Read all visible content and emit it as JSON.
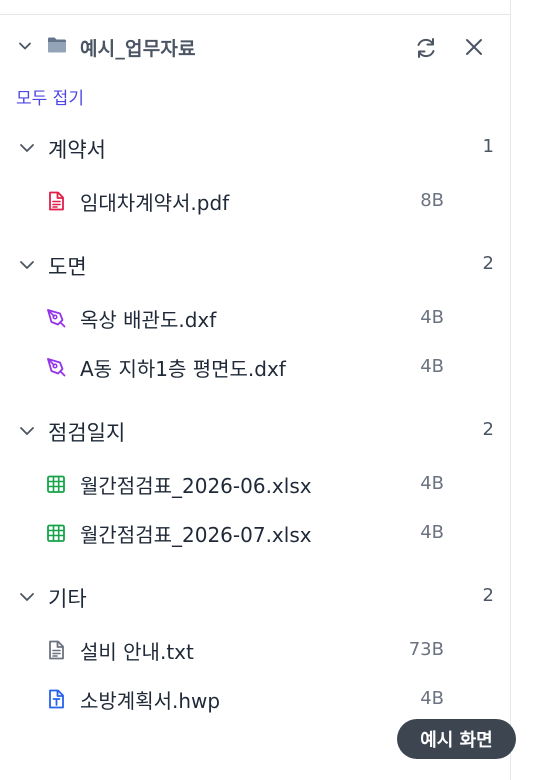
{
  "header": {
    "title": "예시_업무자료",
    "folder_icon": "folder-icon",
    "refresh_icon": "refresh-icon",
    "close_icon": "close-icon"
  },
  "toolbar": {
    "collapse_all_label": "모두 접기"
  },
  "colors": {
    "accent": "#4f46e5",
    "pdf": "#e11d48",
    "dxf": "#9333ea",
    "xlsx": "#16a34a",
    "txt": "#6b7280",
    "hwp": "#2563eb",
    "badge_bg": "#3d4550"
  },
  "groups": [
    {
      "name": "계약서",
      "count": "1",
      "files": [
        {
          "name": "임대차계약서.pdf",
          "size": "8B",
          "icon": "pdf-file-icon"
        }
      ]
    },
    {
      "name": "도면",
      "count": "2",
      "files": [
        {
          "name": "옥상 배관도.dxf",
          "size": "4B",
          "icon": "pen-tool-icon"
        },
        {
          "name": "A동 지하1층 평면도.dxf",
          "size": "4B",
          "icon": "pen-tool-icon"
        }
      ]
    },
    {
      "name": "점검일지",
      "count": "2",
      "files": [
        {
          "name": "월간점검표_2026-06.xlsx",
          "size": "4B",
          "icon": "spreadsheet-icon"
        },
        {
          "name": "월간점검표_2026-07.xlsx",
          "size": "4B",
          "icon": "spreadsheet-icon"
        }
      ]
    },
    {
      "name": "기타",
      "count": "2",
      "files": [
        {
          "name": "설비 안내.txt",
          "size": "73B",
          "icon": "text-file-icon"
        },
        {
          "name": "소방계획서.hwp",
          "size": "4B",
          "icon": "hwp-file-icon"
        }
      ]
    }
  ],
  "badge": {
    "label": "예시 화면"
  }
}
